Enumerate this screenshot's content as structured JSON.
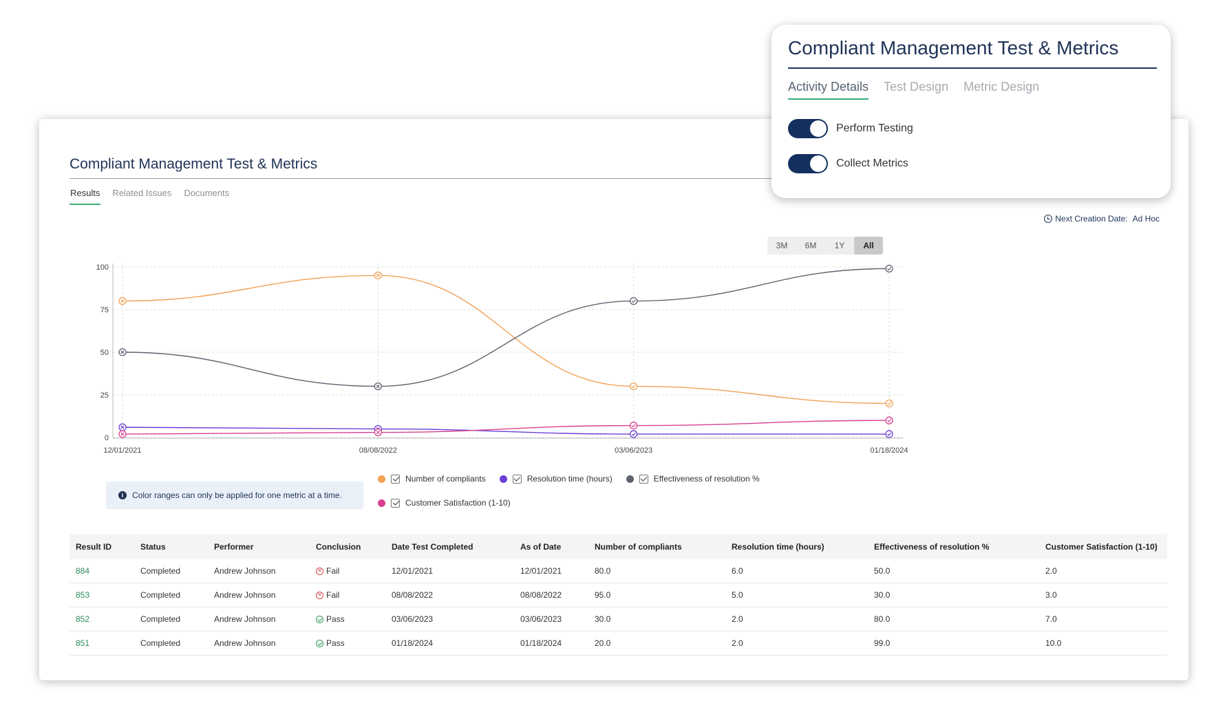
{
  "card": {
    "title": "Compliant Management Test & Metrics",
    "tabs": [
      "Results",
      "Related Issues",
      "Documents"
    ],
    "next_creation_label": "Next Creation Date:",
    "next_creation_value": "Ad Hoc"
  },
  "range_buttons": [
    "3M",
    "6M",
    "1Y",
    "All"
  ],
  "range_active": "All",
  "info_message": "Color ranges can only be applied for one metric at a time.",
  "colors": {
    "compliants": "#f0a155",
    "resolution_time": "#6a3fd6",
    "effectiveness": "#5f6370",
    "satisfaction": "#d8408f",
    "accent_green": "#3cae78",
    "navy": "#1f3356"
  },
  "chart_data": {
    "type": "line",
    "x": [
      "12/01/2021",
      "08/08/2022",
      "03/06/2023",
      "01/18/2024"
    ],
    "ylim": [
      0,
      100
    ],
    "yticks": [
      0,
      25,
      50,
      75,
      100
    ],
    "grid": true,
    "series": [
      {
        "name": "Number of compliants",
        "color": "#f0a155",
        "values": [
          80,
          95,
          30,
          20
        ]
      },
      {
        "name": "Resolution time (hours)",
        "color": "#6a3fd6",
        "values": [
          6,
          5,
          2,
          2
        ]
      },
      {
        "name": "Effectiveness of resolution %",
        "color": "#5f6370",
        "values": [
          50,
          30,
          80,
          99
        ]
      },
      {
        "name": "Customer Satisfaction (1-10)",
        "color": "#d8408f",
        "values": [
          2,
          3,
          7,
          10
        ]
      }
    ],
    "conclusions": [
      "Fail",
      "Fail",
      "Pass",
      "Pass"
    ]
  },
  "table": {
    "headers": [
      "Result ID",
      "Status",
      "Performer",
      "Conclusion",
      "Date Test Completed",
      "As of Date",
      "Number of compliants",
      "Resolution time (hours)",
      "Effectiveness of resolution %",
      "Customer Satisfaction (1-10)"
    ],
    "rows": [
      [
        "884",
        "Completed",
        "Andrew Johnson",
        "Fail",
        "12/01/2021",
        "12/01/2021",
        "80.0",
        "6.0",
        "50.0",
        "2.0"
      ],
      [
        "853",
        "Completed",
        "Andrew Johnson",
        "Fail",
        "08/08/2022",
        "08/08/2022",
        "95.0",
        "5.0",
        "30.0",
        "3.0"
      ],
      [
        "852",
        "Completed",
        "Andrew Johnson",
        "Pass",
        "03/06/2023",
        "03/06/2023",
        "30.0",
        "2.0",
        "80.0",
        "7.0"
      ],
      [
        "851",
        "Completed",
        "Andrew Johnson",
        "Pass",
        "01/18/2024",
        "01/18/2024",
        "20.0",
        "2.0",
        "99.0",
        "10.0"
      ]
    ]
  },
  "popup": {
    "title": "Compliant Management Test & Metrics",
    "tabs": [
      "Activity Details",
      "Test Design",
      "Metric Design"
    ],
    "toggles": [
      {
        "label": "Perform Testing",
        "on": true
      },
      {
        "label": "Collect Metrics",
        "on": true
      }
    ]
  }
}
